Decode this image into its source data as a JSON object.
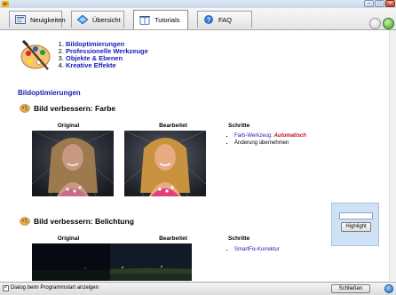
{
  "tabs": [
    {
      "label": "Neuigkeiten",
      "icon": "news-icon"
    },
    {
      "label": "Übersicht",
      "icon": "overview-icon"
    },
    {
      "label": "Tutorials",
      "icon": "book-icon",
      "active": true
    },
    {
      "label": "FAQ",
      "icon": "help-icon"
    }
  ],
  "toc": [
    "Bildoptimierungen",
    "Professionelle Werkzeuge",
    "Objekte & Ebenen",
    "Kreative Effekte"
  ],
  "section": {
    "title": "Bildoptimierungen"
  },
  "lesson1": {
    "title": "Bild verbessern: Farbe",
    "original_label": "Original",
    "edited_label": "Bearbeitet",
    "steps_label": "Schritte",
    "step1_prefix": "Farb-Werkzeug:",
    "step1_value": "Automatisch",
    "step2": "Änderung übernehmen"
  },
  "lesson2": {
    "title": "Bild verbessern: Belichtung",
    "original_label": "Original",
    "edited_label": "Bearbeitet",
    "steps_label": "Schritte",
    "step1": "SmartFix-Korrektur"
  },
  "highlight": {
    "button_label": "Highlight"
  },
  "footer": {
    "checkbox_label": "Dialog beim Programmstart anzeigen",
    "checked": true,
    "close_label": "Schließen"
  },
  "colors": {
    "link": "#1a1ab8",
    "accent_red": "#c0101a",
    "highlight_panel": "#cfe1f4"
  }
}
